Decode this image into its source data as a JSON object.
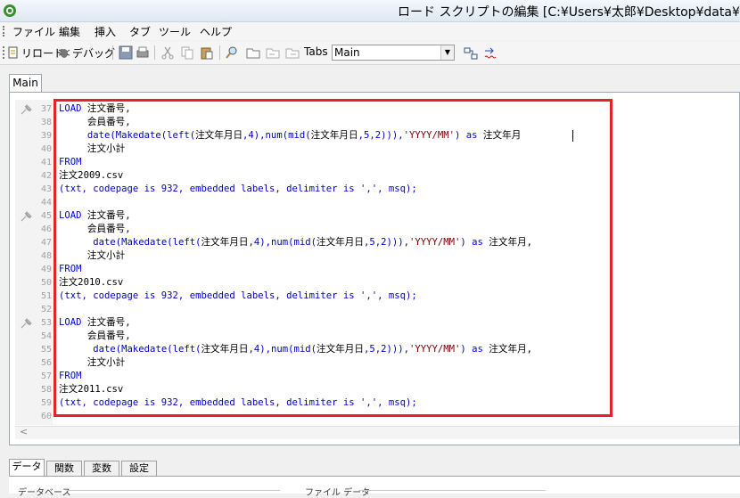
{
  "window": {
    "title": "ロード スクリプトの編集 [C:¥Users¥太郎¥Desktop¥data¥数"
  },
  "menu": [
    "ファイル",
    "編集",
    "挿入",
    "タブ",
    "ツール",
    "ヘルプ"
  ],
  "toolbar": {
    "reload_label": "リロード",
    "debug_label": "デバッグ",
    "tabs_label": "Tabs",
    "tab_select_value": "Main"
  },
  "editor_tab": "Main",
  "lines": [
    {
      "n": "37",
      "pin": true,
      "segs": [
        [
          "kw",
          "LOAD"
        ],
        [
          "fld",
          " 注文番号,"
        ]
      ]
    },
    {
      "n": "38",
      "segs": [
        [
          "fld",
          "     会員番号,"
        ]
      ]
    },
    {
      "n": "39",
      "segs": [
        [
          "fld",
          "     "
        ],
        [
          "fn",
          "date(Makedate(left("
        ],
        [
          "fld",
          "注文年月日"
        ],
        [
          "fn",
          ",4),num(mid("
        ],
        [
          "fld",
          "注文年月日"
        ],
        [
          "fn",
          ",5,2))),"
        ],
        [
          "str",
          "'YYYY/MM'"
        ],
        [
          "fn",
          ") "
        ],
        [
          "kw",
          "as"
        ],
        [
          "fld",
          " 注文年月"
        ]
      ]
    },
    {
      "n": "40",
      "segs": [
        [
          "fld",
          "     注文小計"
        ]
      ]
    },
    {
      "n": "41",
      "segs": [
        [
          "kw",
          "FROM"
        ]
      ]
    },
    {
      "n": "42",
      "segs": [
        [
          "fld",
          "注文2009.csv"
        ]
      ]
    },
    {
      "n": "43",
      "segs": [
        [
          "fn",
          "(txt, codepage is 932, embedded labels, delimiter is ',', msq);"
        ]
      ]
    },
    {
      "n": "44",
      "segs": []
    },
    {
      "n": "45",
      "pin": true,
      "segs": [
        [
          "kw",
          "LOAD"
        ],
        [
          "fld",
          " 注文番号,"
        ]
      ]
    },
    {
      "n": "46",
      "segs": [
        [
          "fld",
          "     会員番号,"
        ]
      ]
    },
    {
      "n": "47",
      "segs": [
        [
          "fld",
          "      "
        ],
        [
          "fn",
          "date(Makedate(left("
        ],
        [
          "fld",
          "注文年月日"
        ],
        [
          "fn",
          ",4),num(mid("
        ],
        [
          "fld",
          "注文年月日"
        ],
        [
          "fn",
          ",5,2))),"
        ],
        [
          "str",
          "'YYYY/MM'"
        ],
        [
          "fn",
          ") "
        ],
        [
          "kw",
          "as"
        ],
        [
          "fld",
          " 注文年月,"
        ]
      ]
    },
    {
      "n": "48",
      "segs": [
        [
          "fld",
          "     注文小計"
        ]
      ]
    },
    {
      "n": "49",
      "segs": [
        [
          "kw",
          "FROM"
        ]
      ]
    },
    {
      "n": "50",
      "segs": [
        [
          "fld",
          "注文2010.csv"
        ]
      ]
    },
    {
      "n": "51",
      "segs": [
        [
          "fn",
          "(txt, codepage is 932, embedded labels, delimiter is ',', msq);"
        ]
      ]
    },
    {
      "n": "52",
      "segs": []
    },
    {
      "n": "53",
      "pin": true,
      "segs": [
        [
          "kw",
          "LOAD"
        ],
        [
          "fld",
          " 注文番号,"
        ]
      ]
    },
    {
      "n": "54",
      "segs": [
        [
          "fld",
          "     会員番号,"
        ]
      ]
    },
    {
      "n": "55",
      "segs": [
        [
          "fld",
          "      "
        ],
        [
          "fn",
          "date(Makedate(left("
        ],
        [
          "fld",
          "注文年月日"
        ],
        [
          "fn",
          ",4),num(mid("
        ],
        [
          "fld",
          "注文年月日"
        ],
        [
          "fn",
          ",5,2))),"
        ],
        [
          "str",
          "'YYYY/MM'"
        ],
        [
          "fn",
          ") "
        ],
        [
          "kw",
          "as"
        ],
        [
          "fld",
          " 注文年月,"
        ]
      ]
    },
    {
      "n": "56",
      "segs": [
        [
          "fld",
          "     注文小計"
        ]
      ]
    },
    {
      "n": "57",
      "segs": [
        [
          "kw",
          "FROM"
        ]
      ]
    },
    {
      "n": "58",
      "segs": [
        [
          "fld",
          "注文2011.csv"
        ]
      ]
    },
    {
      "n": "59",
      "segs": [
        [
          "fn",
          "(txt, codepage is 932, embedded labels, delimiter is ',', msq);"
        ]
      ]
    },
    {
      "n": "60",
      "segs": []
    }
  ],
  "bottom_tabs": [
    "データ",
    "関数",
    "変数",
    "設定"
  ],
  "groups": [
    "データベース",
    "ファイル データ"
  ],
  "colors": {
    "keyword": "#0000ff",
    "function": "#0000c8",
    "string": "#7a0000",
    "highlight_box": "#e8202a"
  }
}
